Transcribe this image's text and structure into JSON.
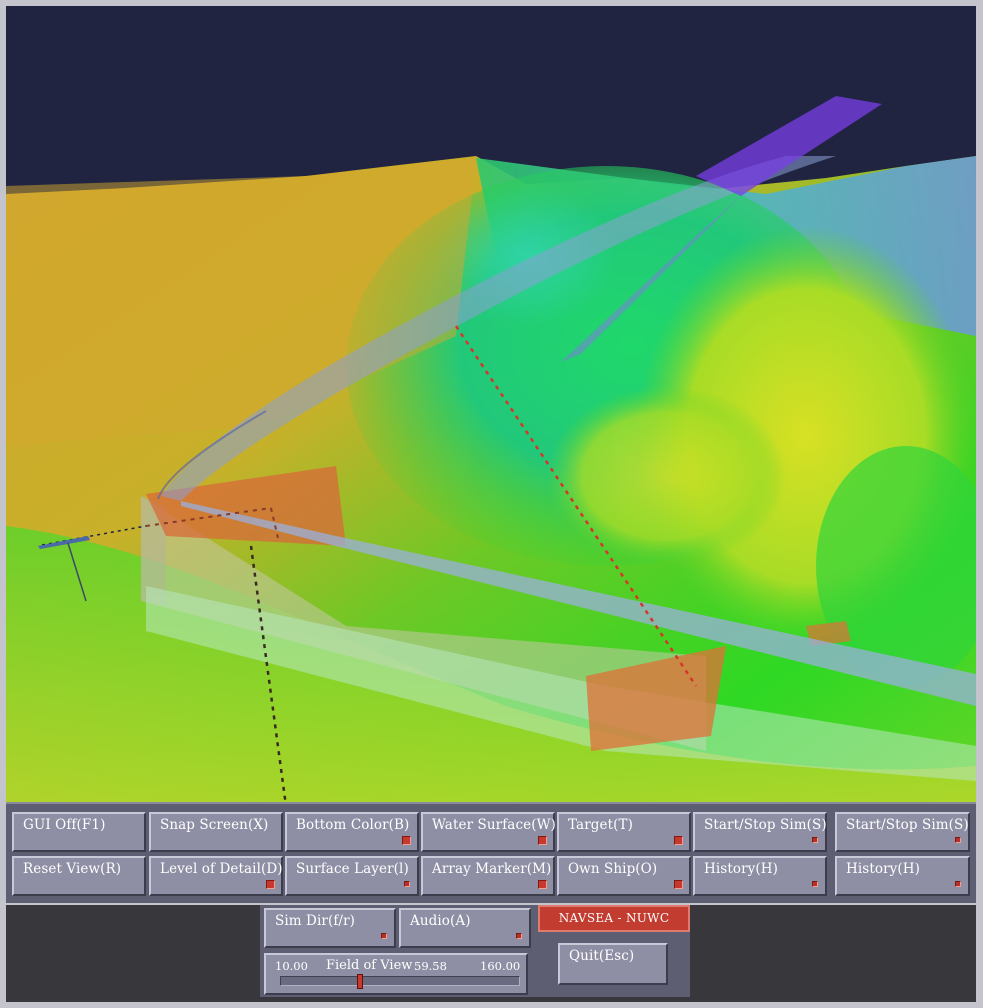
{
  "toolbar_row1": [
    {
      "id": "gui-off",
      "label": "GUI Off(F1)",
      "led": false
    },
    {
      "id": "snap-screen",
      "label": "Snap Screen(X)",
      "led": false
    },
    {
      "id": "bottom-color",
      "label": "Bottom Color(B)",
      "led": true
    },
    {
      "id": "water-surface",
      "label": "Water Surface(W)",
      "led": true
    },
    {
      "id": "target",
      "label": "Target(T)",
      "led": true
    },
    {
      "id": "start-stop-sim",
      "label": "Start/Stop Sim(S)",
      "led": "small"
    },
    {
      "id": "start-stop-sim-2",
      "label": "Start/Stop Sim(S)",
      "led": "small"
    }
  ],
  "toolbar_row2": [
    {
      "id": "reset-view",
      "label": "Reset View(R)",
      "led": false
    },
    {
      "id": "level-of-detail",
      "label": "Level of Detail(D)",
      "led": true
    },
    {
      "id": "surface-layer",
      "label": "Surface Layer(l)",
      "led": "small"
    },
    {
      "id": "array-marker",
      "label": "Array Marker(M)",
      "led": true
    },
    {
      "id": "own-ship",
      "label": "Own Ship(O)",
      "led": true
    },
    {
      "id": "history",
      "label": "History(H)",
      "led": "small"
    },
    {
      "id": "history-2",
      "label": "History(H)",
      "led": "small"
    }
  ],
  "lower": {
    "sim_dir_label": "Sim Dir(f/r)",
    "audio_label": "Audio(A)",
    "brand_label": "NAVSEA - NUWC",
    "quit_label": "Quit(Esc)"
  },
  "field_of_view": {
    "title": "Field of View",
    "min": "10.00",
    "current": "59.58",
    "max": "160.00",
    "min_value": 10,
    "current_value": 59.58,
    "max_value": 160
  },
  "colors": {
    "led_red": "#c9382c",
    "brand_red": "#c23c30",
    "button_face": "#8e8fa4",
    "panel": "#5e5e72",
    "sky": "#202440"
  }
}
